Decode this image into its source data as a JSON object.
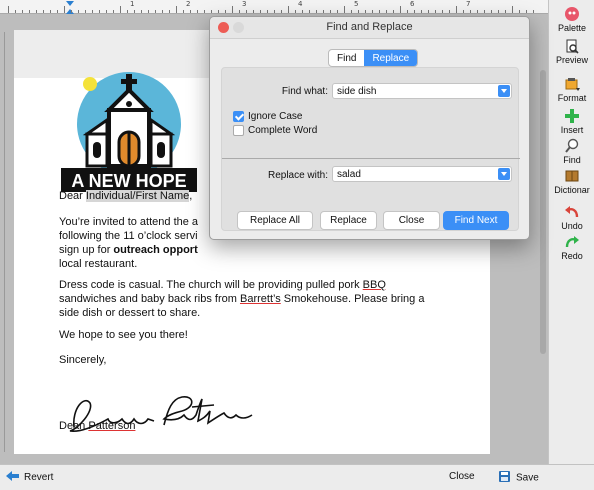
{
  "ruler": {
    "numbers": [
      "1",
      "2",
      "3",
      "4",
      "5",
      "6",
      "7"
    ]
  },
  "document": {
    "salutation_prefix": "Dear ",
    "salutation_field": "Individual/First Name",
    "salutation_suffix": ",",
    "logo_text": "A NEW HOPE",
    "para1_line1": "You’re invited to attend the a",
    "para1_line2": "following the 11 o’clock servi",
    "para1_line3_plain": "sign up for ",
    "para1_line3_bold": "outreach opport",
    "para1_line4": "local restaurant.",
    "para2_line1_a": "Dress code is casual. The church will be providing pulled pork ",
    "para2_line1_b": "BBQ",
    "para2_line2_a": "sandwiches and baby back ribs from ",
    "para2_line2_b": "Barrett’s",
    "para2_line2_c": " Smokehouse. Please bring a",
    "para2_line3": "side dish or dessert to share.",
    "para3": "We hope to see you there!",
    "closing": "Sincerely,",
    "signer_first": "Dean ",
    "signer_last": "Patterson"
  },
  "toolbar": {
    "palette": "Palette",
    "preview": "Preview",
    "format": "Format",
    "insert": "Insert",
    "find": "Find",
    "dictionary": "Dictionar",
    "undo": "Undo",
    "redo": "Redo"
  },
  "bottombar": {
    "revert": "Revert",
    "close": "Close",
    "save": "Save"
  },
  "dialog": {
    "title": "Find and Replace",
    "tabs": {
      "find": "Find",
      "replace": "Replace",
      "active": "Replace"
    },
    "find_what_label": "Find what:",
    "find_what_value": "side dish",
    "ignore_case_label": "Ignore Case",
    "ignore_case_checked": true,
    "complete_word_label": "Complete Word",
    "complete_word_checked": false,
    "replace_with_label": "Replace with:",
    "replace_with_value": "salad",
    "buttons": {
      "replace_all": "Replace All",
      "replace": "Replace",
      "close": "Close",
      "find_next": "Find Next"
    }
  },
  "colors": {
    "accent": "#3b8ff6",
    "logo_circle": "#5bb6d9",
    "sun": "#f4e23a",
    "door": "#e08a2c"
  }
}
